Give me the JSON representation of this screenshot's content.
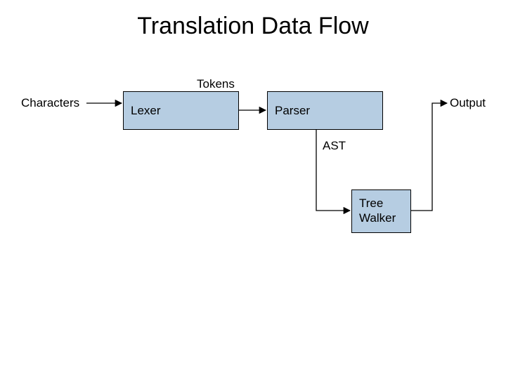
{
  "title": "Translation Data Flow",
  "nodes": {
    "lexer": "Lexer",
    "parser": "Parser",
    "tree_l1": "Tree",
    "tree_l2": "Walker"
  },
  "labels": {
    "characters": "Characters",
    "tokens": "Tokens",
    "ast": "AST",
    "output": "Output"
  },
  "colors": {
    "box_fill": "#b6cde2",
    "box_stroke": "#000000",
    "arrow": "#000000",
    "background": "#ffffff",
    "text": "#000000"
  }
}
